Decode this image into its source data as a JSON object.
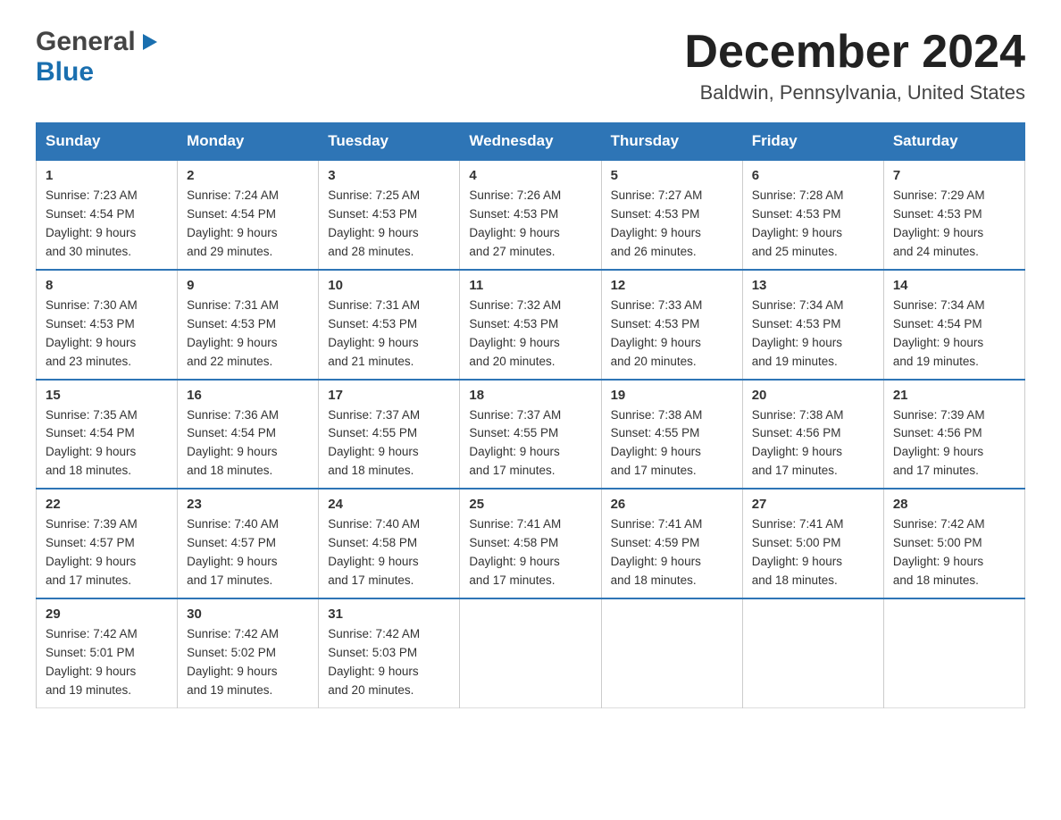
{
  "header": {
    "logo_general": "General",
    "logo_blue": "Blue",
    "month": "December 2024",
    "location": "Baldwin, Pennsylvania, United States"
  },
  "days_of_week": [
    "Sunday",
    "Monday",
    "Tuesday",
    "Wednesday",
    "Thursday",
    "Friday",
    "Saturday"
  ],
  "weeks": [
    [
      {
        "day": "1",
        "sunrise": "7:23 AM",
        "sunset": "4:54 PM",
        "daylight": "9 hours and 30 minutes."
      },
      {
        "day": "2",
        "sunrise": "7:24 AM",
        "sunset": "4:54 PM",
        "daylight": "9 hours and 29 minutes."
      },
      {
        "day": "3",
        "sunrise": "7:25 AM",
        "sunset": "4:53 PM",
        "daylight": "9 hours and 28 minutes."
      },
      {
        "day": "4",
        "sunrise": "7:26 AM",
        "sunset": "4:53 PM",
        "daylight": "9 hours and 27 minutes."
      },
      {
        "day": "5",
        "sunrise": "7:27 AM",
        "sunset": "4:53 PM",
        "daylight": "9 hours and 26 minutes."
      },
      {
        "day": "6",
        "sunrise": "7:28 AM",
        "sunset": "4:53 PM",
        "daylight": "9 hours and 25 minutes."
      },
      {
        "day": "7",
        "sunrise": "7:29 AM",
        "sunset": "4:53 PM",
        "daylight": "9 hours and 24 minutes."
      }
    ],
    [
      {
        "day": "8",
        "sunrise": "7:30 AM",
        "sunset": "4:53 PM",
        "daylight": "9 hours and 23 minutes."
      },
      {
        "day": "9",
        "sunrise": "7:31 AM",
        "sunset": "4:53 PM",
        "daylight": "9 hours and 22 minutes."
      },
      {
        "day": "10",
        "sunrise": "7:31 AM",
        "sunset": "4:53 PM",
        "daylight": "9 hours and 21 minutes."
      },
      {
        "day": "11",
        "sunrise": "7:32 AM",
        "sunset": "4:53 PM",
        "daylight": "9 hours and 20 minutes."
      },
      {
        "day": "12",
        "sunrise": "7:33 AM",
        "sunset": "4:53 PM",
        "daylight": "9 hours and 20 minutes."
      },
      {
        "day": "13",
        "sunrise": "7:34 AM",
        "sunset": "4:53 PM",
        "daylight": "9 hours and 19 minutes."
      },
      {
        "day": "14",
        "sunrise": "7:34 AM",
        "sunset": "4:54 PM",
        "daylight": "9 hours and 19 minutes."
      }
    ],
    [
      {
        "day": "15",
        "sunrise": "7:35 AM",
        "sunset": "4:54 PM",
        "daylight": "9 hours and 18 minutes."
      },
      {
        "day": "16",
        "sunrise": "7:36 AM",
        "sunset": "4:54 PM",
        "daylight": "9 hours and 18 minutes."
      },
      {
        "day": "17",
        "sunrise": "7:37 AM",
        "sunset": "4:55 PM",
        "daylight": "9 hours and 18 minutes."
      },
      {
        "day": "18",
        "sunrise": "7:37 AM",
        "sunset": "4:55 PM",
        "daylight": "9 hours and 17 minutes."
      },
      {
        "day": "19",
        "sunrise": "7:38 AM",
        "sunset": "4:55 PM",
        "daylight": "9 hours and 17 minutes."
      },
      {
        "day": "20",
        "sunrise": "7:38 AM",
        "sunset": "4:56 PM",
        "daylight": "9 hours and 17 minutes."
      },
      {
        "day": "21",
        "sunrise": "7:39 AM",
        "sunset": "4:56 PM",
        "daylight": "9 hours and 17 minutes."
      }
    ],
    [
      {
        "day": "22",
        "sunrise": "7:39 AM",
        "sunset": "4:57 PM",
        "daylight": "9 hours and 17 minutes."
      },
      {
        "day": "23",
        "sunrise": "7:40 AM",
        "sunset": "4:57 PM",
        "daylight": "9 hours and 17 minutes."
      },
      {
        "day": "24",
        "sunrise": "7:40 AM",
        "sunset": "4:58 PM",
        "daylight": "9 hours and 17 minutes."
      },
      {
        "day": "25",
        "sunrise": "7:41 AM",
        "sunset": "4:58 PM",
        "daylight": "9 hours and 17 minutes."
      },
      {
        "day": "26",
        "sunrise": "7:41 AM",
        "sunset": "4:59 PM",
        "daylight": "9 hours and 18 minutes."
      },
      {
        "day": "27",
        "sunrise": "7:41 AM",
        "sunset": "5:00 PM",
        "daylight": "9 hours and 18 minutes."
      },
      {
        "day": "28",
        "sunrise": "7:42 AM",
        "sunset": "5:00 PM",
        "daylight": "9 hours and 18 minutes."
      }
    ],
    [
      {
        "day": "29",
        "sunrise": "7:42 AM",
        "sunset": "5:01 PM",
        "daylight": "9 hours and 19 minutes."
      },
      {
        "day": "30",
        "sunrise": "7:42 AM",
        "sunset": "5:02 PM",
        "daylight": "9 hours and 19 minutes."
      },
      {
        "day": "31",
        "sunrise": "7:42 AM",
        "sunset": "5:03 PM",
        "daylight": "9 hours and 20 minutes."
      },
      null,
      null,
      null,
      null
    ]
  ],
  "labels": {
    "sunrise": "Sunrise:",
    "sunset": "Sunset:",
    "daylight": "Daylight:"
  }
}
